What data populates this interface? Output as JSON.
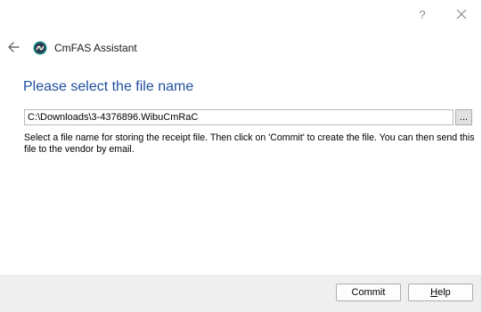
{
  "window": {
    "help_glyph": "?",
    "close_icon": "close-icon"
  },
  "header": {
    "app_name": "CmFAS Assistant",
    "back_icon": "back-arrow-icon",
    "logo_icon": "codemeter-logo-icon"
  },
  "page": {
    "title": "Please select the file name",
    "file_path": "C:\\Downloads\\3-4376896.WibuCmRaC",
    "browse_label": "...",
    "description": "Select a file name for storing the receipt file. Then click on 'Commit' to create the file. You can then send this file to the vendor by email."
  },
  "footer": {
    "commit_label": "Commit",
    "help_label_mnemonic": "H",
    "help_label_rest": "elp"
  },
  "colors": {
    "title_blue": "#1f4e9e",
    "footer_bg": "#efefef",
    "logo_teal": "#1b8a8a"
  }
}
